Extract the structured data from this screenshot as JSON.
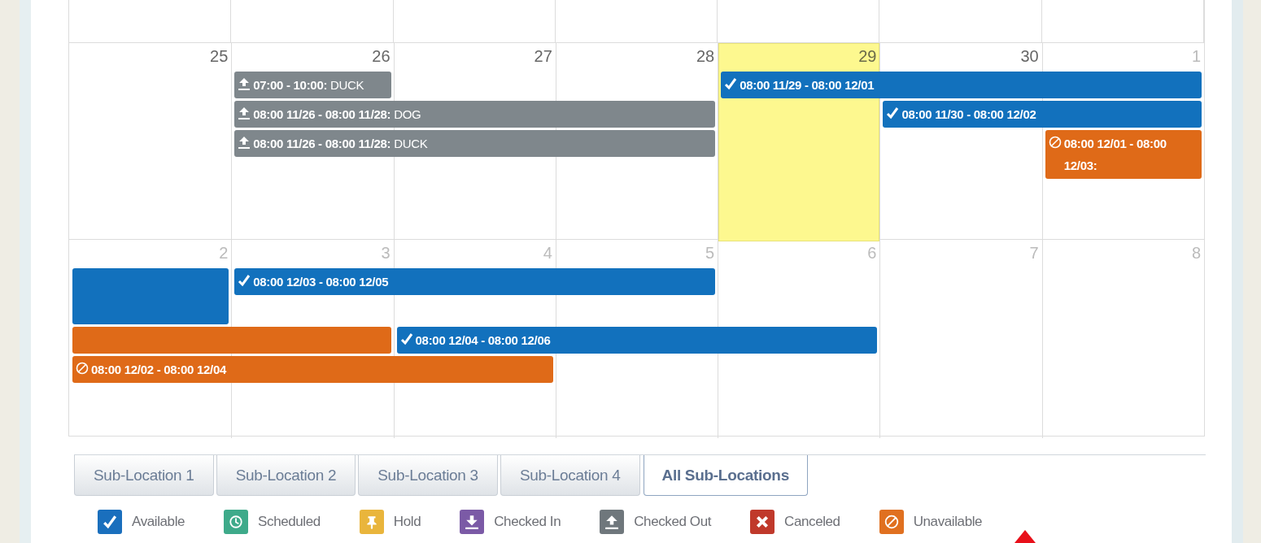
{
  "calendar": {
    "weeks": [
      {
        "days": [
          {
            "label": "25",
            "other_month": false,
            "today": false
          },
          {
            "label": "26",
            "other_month": false,
            "today": false
          },
          {
            "label": "27",
            "other_month": false,
            "today": false
          },
          {
            "label": "28",
            "other_month": false,
            "today": false
          },
          {
            "label": "29",
            "other_month": false,
            "today": true
          },
          {
            "label": "30",
            "other_month": false,
            "today": false
          },
          {
            "label": "1",
            "other_month": true,
            "today": false
          }
        ],
        "lanes": [
          [
            {
              "kind": "gap"
            },
            {
              "kind": "checked_out",
              "continued": false,
              "time": "07:00 - 10:00:",
              "title": "DUCK"
            },
            {
              "kind": "gap"
            },
            {
              "kind": "gap"
            },
            {
              "kind": "available",
              "continued": false,
              "time": "08:00 11/29 - 08:00 12/01"
            },
            {
              "kind": "more"
            },
            {
              "kind": "more"
            }
          ],
          [
            {
              "kind": "gap"
            },
            {
              "kind": "checked_out",
              "continued": false,
              "time": "08:00 11/26 - 08:00 11/28:",
              "title": "DOG"
            },
            {
              "kind": "more"
            },
            {
              "kind": "more"
            },
            {
              "kind": "gap"
            },
            {
              "kind": "available",
              "continued": false,
              "time": "08:00 11/30 - 08:00 12/02"
            },
            {
              "kind": "more"
            }
          ],
          [
            {
              "kind": "gap"
            },
            {
              "kind": "checked_out",
              "continued": false,
              "time": "08:00 11/26 - 08:00 11/28:",
              "title": "DUCK"
            },
            {
              "kind": "more"
            },
            {
              "kind": "more"
            },
            {
              "kind": "gap"
            },
            {
              "kind": "gap"
            },
            {
              "kind": "unavailable",
              "continued": false,
              "time": "08:00 12/01 - 08:00 12/03:"
            }
          ]
        ]
      },
      {
        "days": [
          {
            "label": "2",
            "other_month": true,
            "today": false
          },
          {
            "label": "3",
            "other_month": true,
            "today": false
          },
          {
            "label": "4",
            "other_month": true,
            "today": false
          },
          {
            "label": "5",
            "other_month": true,
            "today": false
          },
          {
            "label": "6",
            "other_month": true,
            "today": false
          },
          {
            "label": "7",
            "other_month": true,
            "today": false
          },
          {
            "label": "8",
            "other_month": true,
            "today": false
          }
        ],
        "lanes": [
          [
            {
              "kind": "available",
              "continued": true
            },
            {
              "kind": "available",
              "continued": false,
              "time": "08:00 12/03 - 08:00 12/05"
            },
            {
              "kind": "more"
            },
            {
              "kind": "more"
            },
            {
              "kind": "gap"
            },
            {
              "kind": "gap"
            },
            {
              "kind": "gap"
            }
          ],
          [
            {
              "kind": "below"
            },
            {
              "kind": "gap"
            },
            {
              "kind": "gap"
            },
            {
              "kind": "gap"
            },
            {
              "kind": "gap"
            },
            {
              "kind": "gap"
            },
            {
              "kind": "gap"
            }
          ],
          [
            {
              "kind": "unavailable",
              "continued": true
            },
            {
              "kind": "more"
            },
            {
              "kind": "available",
              "continued": false,
              "time": "08:00 12/04 - 08:00 12/06"
            },
            {
              "kind": "more"
            },
            {
              "kind": "more"
            },
            {
              "kind": "gap"
            },
            {
              "kind": "gap"
            }
          ],
          [
            {
              "kind": "unavailable",
              "continued": false,
              "time": "08:00 12/02 - 08:00 12/04"
            },
            {
              "kind": "more"
            },
            {
              "kind": "more"
            },
            {
              "kind": "gap"
            },
            {
              "kind": "gap"
            },
            {
              "kind": "gap"
            },
            {
              "kind": "gap"
            }
          ]
        ]
      }
    ]
  },
  "tabs": [
    {
      "label": "Sub-Location 1",
      "selected": false
    },
    {
      "label": "Sub-Location 2",
      "selected": false
    },
    {
      "label": "Sub-Location 3",
      "selected": false
    },
    {
      "label": "Sub-Location 4",
      "selected": false
    },
    {
      "label": "All Sub-Locations",
      "selected": true
    }
  ],
  "legend": [
    {
      "kind": "available",
      "label": "Available",
      "color": "#1a6fbd"
    },
    {
      "kind": "scheduled",
      "label": "Scheduled",
      "color": "#3eaa8a"
    },
    {
      "kind": "hold",
      "label": "Hold",
      "color": "#e9b53c"
    },
    {
      "kind": "checked_in",
      "label": "Checked In",
      "color": "#7b5aa6"
    },
    {
      "kind": "checked_out",
      "label": "Checked Out",
      "color": "#6f777c"
    },
    {
      "kind": "canceled",
      "label": "Canceled",
      "color": "#c0392b"
    },
    {
      "kind": "unavailable",
      "label": "Unavailable",
      "color": "#e07020"
    }
  ]
}
